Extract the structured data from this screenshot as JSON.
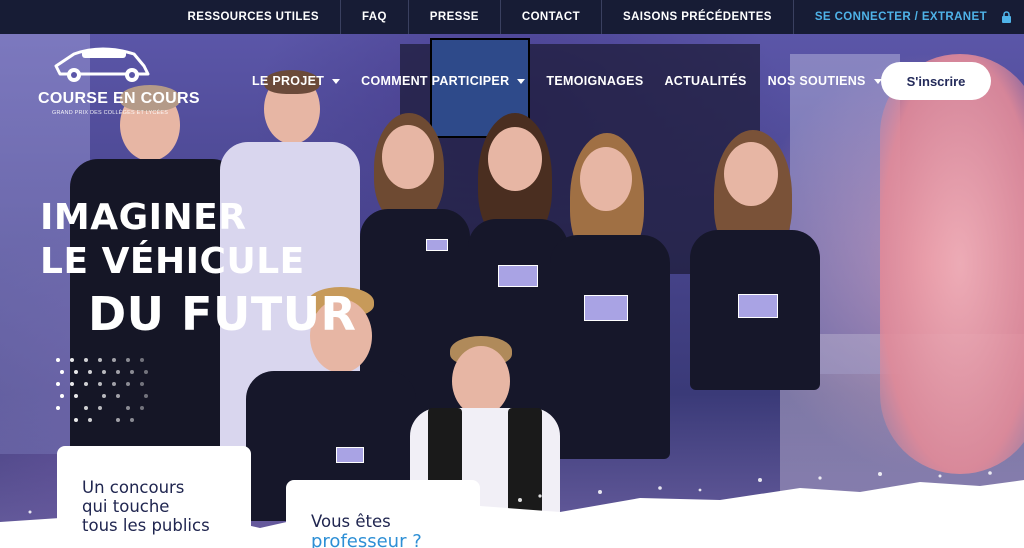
{
  "topbar": {
    "links": [
      "RESSOURCES UTILES",
      "FAQ",
      "PRESSE",
      "CONTACT",
      "SAISONS PRÉCÉDENTES"
    ],
    "login_label": "SE CONNECTER / EXTRANET",
    "login_icon": "lock-icon"
  },
  "logo": {
    "brand": "COURSE EN COURS",
    "tagline": "GRAND PRIX DES COLLÈGES ET LYCÉES"
  },
  "nav": {
    "items": [
      {
        "label": "LE PROJET",
        "dropdown": true
      },
      {
        "label": "COMMENT PARTICIPER",
        "dropdown": true
      },
      {
        "label": "TEMOIGNAGES",
        "dropdown": false
      },
      {
        "label": "ACTUALITÉS",
        "dropdown": false
      },
      {
        "label": "NOS SOUTIENS",
        "dropdown": true
      }
    ],
    "signup_label": "S'inscrire"
  },
  "hero": {
    "line1": "IMAGINER",
    "line2": "LE VÉHICULE",
    "line3": "DU FUTUR"
  },
  "cards": {
    "card1": {
      "line1": "Un concours",
      "line2": "qui touche",
      "line3": "tous les publics"
    },
    "card2": {
      "line1": "Vous êtes",
      "line2": "professeur ?"
    }
  },
  "colors": {
    "topbar_bg": "#171c35",
    "accent_blue": "#4fb3e8",
    "card_title": "#202650",
    "card_accent": "#2d8fd5"
  }
}
